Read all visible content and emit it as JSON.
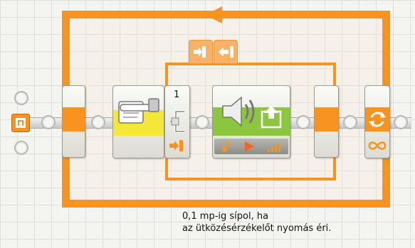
{
  "canvas": {
    "theme_color": "#f7931e",
    "grid_color": "#e2e0d6"
  },
  "blocks": [
    {
      "id": "start",
      "icon": "start-point-icon"
    },
    {
      "id": "loop_start",
      "icon": "loop-begin-icon"
    },
    {
      "id": "wait",
      "icon": "touch-sensor-hand-icon"
    },
    {
      "id": "switch",
      "port_number": "1",
      "icons": [
        "switch-fork-icon",
        "sensor-port-icon"
      ]
    },
    {
      "id": "sound",
      "icons": [
        "speaker-icon",
        "play-icon",
        "note-icon",
        "volume-icon"
      ]
    },
    {
      "id": "switch_end",
      "icon": "switch-merge-icon"
    },
    {
      "id": "loop_end",
      "icons": [
        "loop-arrows-icon",
        "infinity-icon"
      ]
    }
  ],
  "switch_tabs": [
    {
      "icon": "switch-tab-true-icon"
    },
    {
      "icon": "switch-tab-false-icon"
    }
  ],
  "comment": {
    "line1": "0,1 mp-ig sípol, ha",
    "line2": "az ütközésérzékelőt nyomás éri."
  }
}
